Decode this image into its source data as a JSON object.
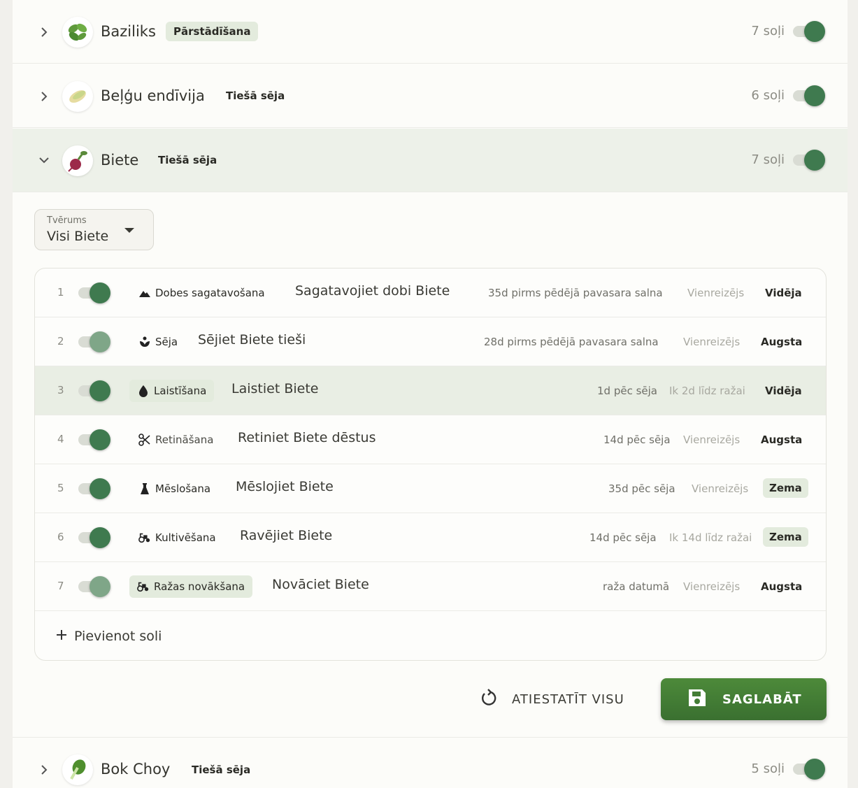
{
  "crops": [
    {
      "name": "Baziliks",
      "method": "Pārstādīšana",
      "steps": "7 soļi",
      "expanded": false,
      "enabled": true,
      "icon": "basil-icon"
    },
    {
      "name": "Beļģu endīvija",
      "method": "Tiešā sēja",
      "steps": "6 soļi",
      "expanded": false,
      "enabled": true,
      "icon": "endive-icon"
    },
    {
      "name": "Biete",
      "method": "Tiešā sēja",
      "steps": "7 soļi",
      "expanded": true,
      "enabled": true,
      "icon": "beet-icon"
    },
    {
      "name": "Bok Choy",
      "method": "Tiešā sēja",
      "steps": "5 soļi",
      "expanded": false,
      "enabled": true,
      "icon": "bok-choy-icon"
    }
  ],
  "scope": {
    "label": "Tvērums",
    "value": "Visi Biete"
  },
  "steps": [
    {
      "num": "1",
      "tag": "Dobes sagatavošana",
      "icon": "mountain-icon",
      "title": "Sagatavojiet dobi Biete",
      "timing": "35d pirms pēdējā pavasara salna",
      "freq": "Vienreizējs",
      "priority": "Vidēja",
      "enabled": true
    },
    {
      "num": "2",
      "tag": "Sēja",
      "icon": "sprout-icon",
      "title": "Sējiet Biete tieši",
      "timing": "28d pirms pēdējā pavasara salna",
      "freq": "Vienreizējs",
      "priority": "Augsta",
      "enabled": true
    },
    {
      "num": "3",
      "tag": "Laistīšana",
      "icon": "water-drop-icon",
      "title": "Laistiet Biete",
      "timing": "1d pēc sēja",
      "freq": "Ik 2d līdz ražai",
      "priority": "Vidēja",
      "enabled": true
    },
    {
      "num": "4",
      "tag": "Retināšana",
      "icon": "scissors-icon",
      "title": "Retiniet Biete dēstus",
      "timing": "14d pēc sēja",
      "freq": "Vienreizējs",
      "priority": "Augsta",
      "enabled": true
    },
    {
      "num": "5",
      "tag": "Mēslošana",
      "icon": "flask-icon",
      "title": "Mēslojiet Biete",
      "timing": "35d pēc sēja",
      "freq": "Vienreizējs",
      "priority": "Zema",
      "enabled": true
    },
    {
      "num": "6",
      "tag": "Kultivēšana",
      "icon": "tractor-icon",
      "title": "Ravējiet Biete",
      "timing": "14d pēc sēja",
      "freq": "Ik 14d līdz ražai",
      "priority": "Zema",
      "enabled": true
    },
    {
      "num": "7",
      "tag": "Ražas novākšana",
      "icon": "tractor-icon",
      "title": "Novāciet Biete",
      "timing": "raža datumā",
      "freq": "Vienreizējs",
      "priority": "Augsta",
      "enabled": true
    }
  ],
  "add_step_label": "Pievienot soli",
  "reset_label": "ATIESTATĪT VISU",
  "save_label": "SAGLABĀT",
  "colors": {
    "accent": "#3f7a4f",
    "save": "#437d35",
    "highlight": "#e9eee4",
    "pill": "#e3ebdd"
  }
}
